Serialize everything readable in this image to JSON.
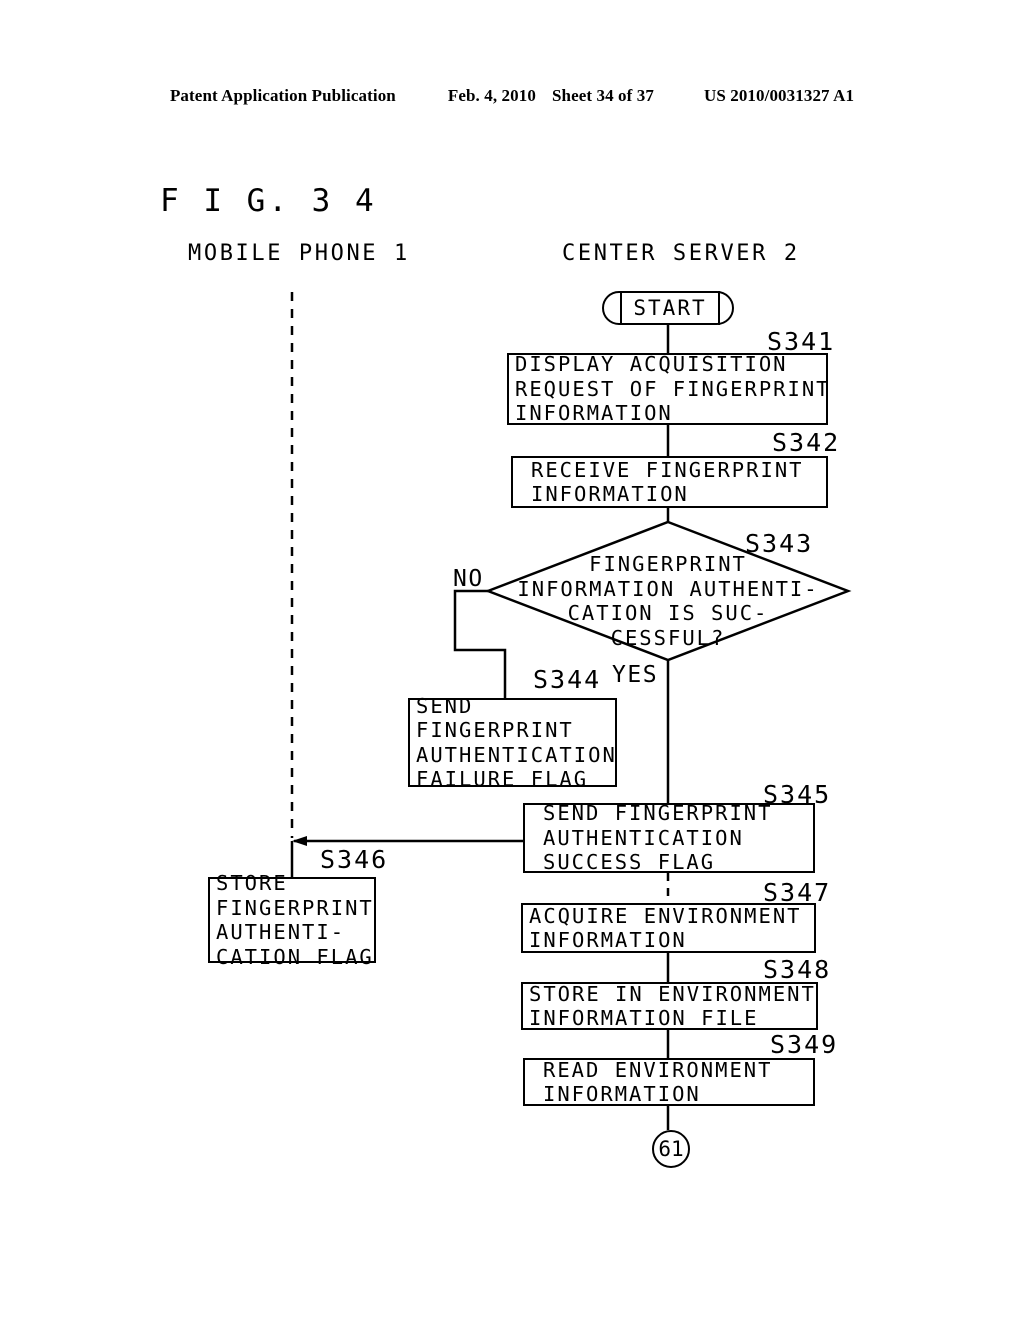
{
  "header": {
    "publication": "Patent Application Publication",
    "date": "Feb. 4, 2010",
    "sheet": "Sheet 34 of 37",
    "number": "US 2010/0031327 A1"
  },
  "figure": {
    "title": "F I G. 3 4",
    "lanes": {
      "left": "MOBILE PHONE 1",
      "right": "CENTER SERVER 2"
    },
    "terminal_start": "START",
    "connector": "61",
    "branch_no": "NO",
    "branch_yes": "YES",
    "steps": {
      "s341": {
        "number": "S341",
        "text": "DISPLAY ACQUISITION\nREQUEST OF FINGERPRINT\nINFORMATION"
      },
      "s342": {
        "number": "S342",
        "text": "RECEIVE FINGERPRINT\nINFORMATION"
      },
      "s343": {
        "number": "S343",
        "text": "FINGERPRINT\nINFORMATION AUTHENTI-\nCATION IS SUC-\nCESSFUL?"
      },
      "s344": {
        "number": "S344",
        "text": "SEND\nFINGERPRINT\nAUTHENTICATION\nFAILURE FLAG"
      },
      "s345": {
        "number": "S345",
        "text": "SEND FINGERPRINT\nAUTHENTICATION\nSUCCESS FLAG"
      },
      "s346": {
        "number": "S346",
        "text": "STORE\nFINGERPRINT\nAUTHENTI-\nCATION FLAG"
      },
      "s347": {
        "number": "S347",
        "text": "ACQUIRE ENVIRONMENT\nINFORMATION"
      },
      "s348": {
        "number": "S348",
        "text": "STORE IN ENVIRONMENT\nINFORMATION FILE"
      },
      "s349": {
        "number": "S349",
        "text": "READ ENVIRONMENT\nINFORMATION"
      }
    }
  },
  "colors": {
    "ink": "#000000",
    "paper": "#ffffff"
  }
}
